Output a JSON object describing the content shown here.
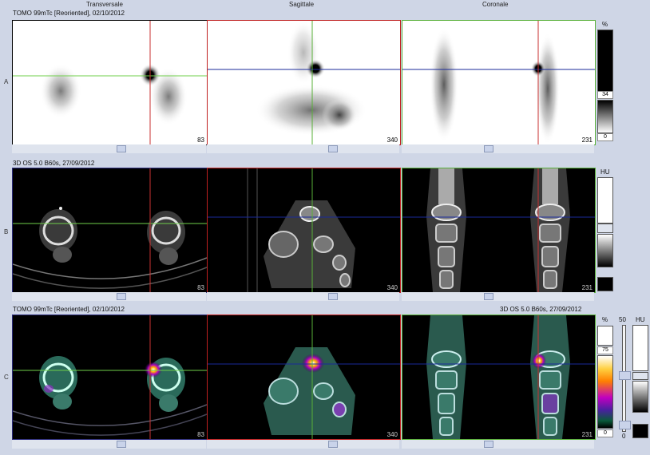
{
  "columns": [
    "Transversale",
    "Sagittale",
    "Coronale"
  ],
  "rows": [
    "A",
    "B",
    "C"
  ],
  "titles": {
    "a": "TOMO 99mTc [Reoriented], 02/10/2012",
    "b": "3D  OS  5.0  B60s, 27/09/2012",
    "c_left": "TOMO 99mTc [Reoriented], 02/10/2012",
    "c_right": "3D  OS  5.0  B60s, 27/09/2012"
  },
  "slices": {
    "a": [
      "83",
      "340",
      "231"
    ],
    "b": [
      "83",
      "340",
      "231"
    ],
    "c": [
      "83",
      "340",
      "231"
    ]
  },
  "scales": {
    "a_unit": "%",
    "a_value": "34",
    "a_min": "0",
    "b_unit": "HU",
    "c_unit": "%",
    "c_value": "75",
    "c_min": "0",
    "c_window": "50",
    "c_window_min": "0",
    "c_hu_unit": "HU"
  },
  "colors": {
    "transversal_frame": "#000000",
    "sagittal_frame": "#c02020",
    "coronal_frame": "#58b038",
    "crosshair_h_a": "#6fcf4a",
    "crosshair_v": "#c83232",
    "crosshair_blue": "#1a2a9a",
    "selected_frame": "#2a2a7a"
  }
}
